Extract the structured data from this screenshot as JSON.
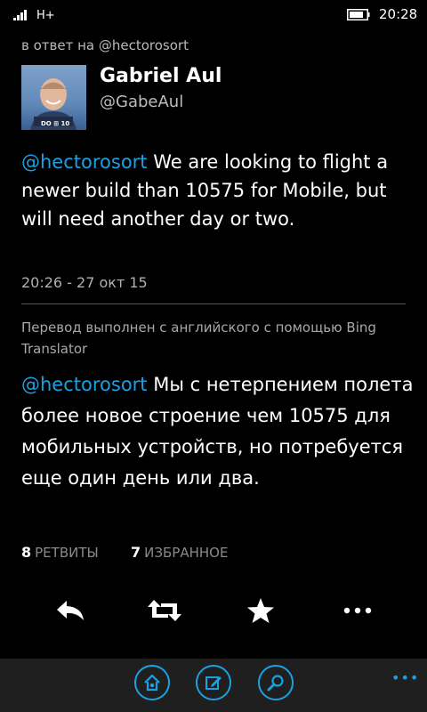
{
  "status_bar": {
    "network": "H+",
    "time": "20:28",
    "icons": [
      "signal-icon",
      "battery-icon"
    ]
  },
  "tweet": {
    "reply_to": "в ответ на @hectorosort",
    "author_name": "Gabriel Aul",
    "author_handle": "@GabeAul",
    "avatar_badge": "DO ⊞ 10",
    "mention": "@hectorosort",
    "text": " We are looking to flight a newer build than 10575 for Mobile, but will need another day or two.",
    "timestamp": "20:26 - 27 окт 15"
  },
  "translation": {
    "note": "Перевод выполнен с английского с помощью Bing Translator",
    "mention": "@hectorosort",
    "text": " Мы с нетерпением полета более новое строение чем 10575 для мобильных устройств, но потребуется еще один день или два."
  },
  "stats": {
    "retweets_count": "8",
    "retweets_label": "РЕТВИТЫ",
    "favorites_count": "7",
    "favorites_label": "ИЗБРАННОЕ"
  },
  "actions": [
    "reply-icon",
    "retweet-icon",
    "favorite-star-icon",
    "more-icon"
  ],
  "app_bar": {
    "buttons": [
      "home-icon",
      "compose-icon",
      "search-icon"
    ],
    "more": "•••"
  },
  "colors": {
    "accent": "#1ba1e2",
    "background": "#000000",
    "app_bar": "#1f1f1f"
  }
}
